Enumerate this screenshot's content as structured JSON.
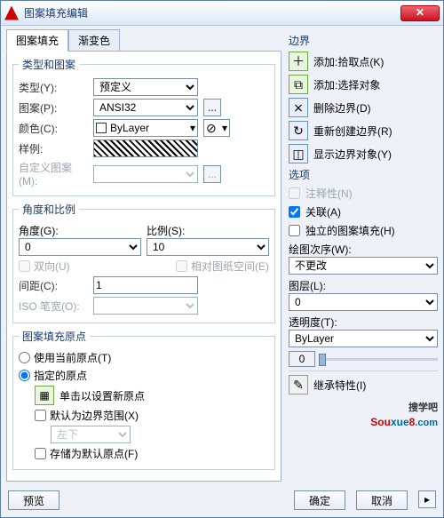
{
  "title": "图案填充编辑",
  "tabs": {
    "hatch": "图案填充",
    "gradient": "渐变色"
  },
  "typePattern": {
    "legend": "类型和图案",
    "typeLabel": "类型(Y):",
    "typeValue": "预定义",
    "patternLabel": "图案(P):",
    "patternValue": "ANSI32",
    "colorLabel": "颜色(C):",
    "colorValue": "ByLayer",
    "sampleLabel": "样例:",
    "customLabel": "自定义图案(M):",
    "dots": "..."
  },
  "angleScale": {
    "legend": "角度和比例",
    "angleLabel": "角度(G):",
    "angleValue": "0",
    "scaleLabel": "比例(S):",
    "scaleValue": "10",
    "double": "双向(U)",
    "paperspace": "相对图纸空间(E)",
    "spacingLabel": "间距(C):",
    "spacingValue": "1",
    "isoPenLabel": "ISO 笔宽(O):"
  },
  "origin": {
    "legend": "图案填充原点",
    "useCurrent": "使用当前原点(T)",
    "specified": "指定的原点",
    "clickSet": "单击以设置新原点",
    "defaultExtents": "默认为边界范围(X)",
    "extentsValue": "左下",
    "storeDefault": "存储为默认原点(F)"
  },
  "boundaries": {
    "title": "边界",
    "addPick": "添加:拾取点(K)",
    "addSelect": "添加:选择对象",
    "remove": "删除边界(D)",
    "recreate": "重新创建边界(R)",
    "display": "显示边界对象(Y)"
  },
  "options": {
    "title": "选项",
    "annotative": "注释性(N)",
    "associative": "关联(A)",
    "separate": "独立的图案填充(H)",
    "drawOrderLabel": "绘图次序(W):",
    "drawOrderValue": "不更改",
    "layerLabel": "图层(L):",
    "layerValue": "0",
    "transparencyLabel": "透明度(T):",
    "transparencyValue": "ByLayer",
    "sliderValue": "0"
  },
  "inherit": "继承特性(I)",
  "buttons": {
    "preview": "预览",
    "ok": "确定",
    "cancel": "取消"
  },
  "logo": {
    "small": "搜学吧",
    "brand1": "Sou",
    "brand2": "xue",
    "brand3": "8",
    "dom": ".com"
  }
}
